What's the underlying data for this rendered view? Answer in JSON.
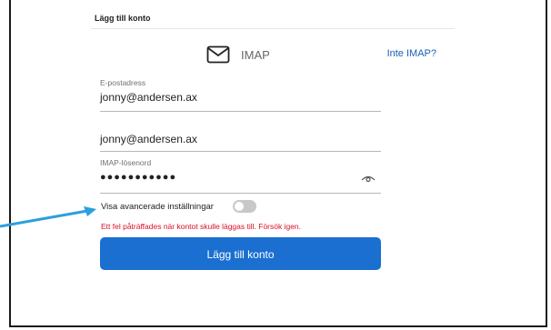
{
  "header": {
    "title": "Lägg till konto"
  },
  "imap": {
    "label": "IMAP",
    "not_imap_link": "Inte IMAP?"
  },
  "fields": {
    "email": {
      "label": "E-postadress",
      "value": "jonny@andersen.ax"
    },
    "username": {
      "value": "jonny@andersen.ax"
    },
    "password": {
      "label": "IMAP-lösenord",
      "value": "●●●●●●●●●●●"
    }
  },
  "advanced": {
    "label": "Visa avancerade inställningar",
    "enabled": false
  },
  "error": {
    "message": "Ett fel påträffades när kontot skulle läggas till. Försök igen."
  },
  "button": {
    "label": "Lägg till konto"
  },
  "colors": {
    "accent": "#1a6fd0",
    "error": "#d8102a",
    "link": "#1a5fb4",
    "annotation_arrow": "#2aa0dd"
  }
}
